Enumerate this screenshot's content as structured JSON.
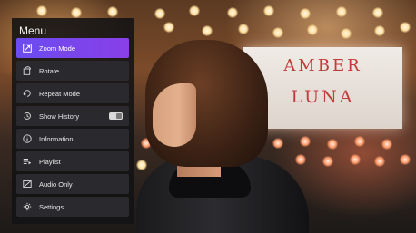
{
  "menu": {
    "title": "Menu",
    "items": [
      {
        "label": "Zoom Mode",
        "icon": "zoom-mode-icon",
        "active": true
      },
      {
        "label": "Rotate",
        "icon": "rotate-icon",
        "active": false
      },
      {
        "label": "Repeat Mode",
        "icon": "repeat-icon",
        "active": false
      },
      {
        "label": "Show History",
        "icon": "history-icon",
        "active": false,
        "toggle": "off"
      },
      {
        "label": "Information",
        "icon": "info-icon",
        "active": false
      },
      {
        "label": "Playlist",
        "icon": "playlist-icon",
        "active": false
      },
      {
        "label": "Audio Only",
        "icon": "audio-only-icon",
        "active": false
      },
      {
        "label": "Settings",
        "icon": "settings-icon",
        "active": false
      }
    ],
    "accent_gradient": [
      "#6a4cf0",
      "#8a3fe8"
    ]
  },
  "video": {
    "sign_lines": [
      "AMBER",
      "LUNA"
    ]
  }
}
